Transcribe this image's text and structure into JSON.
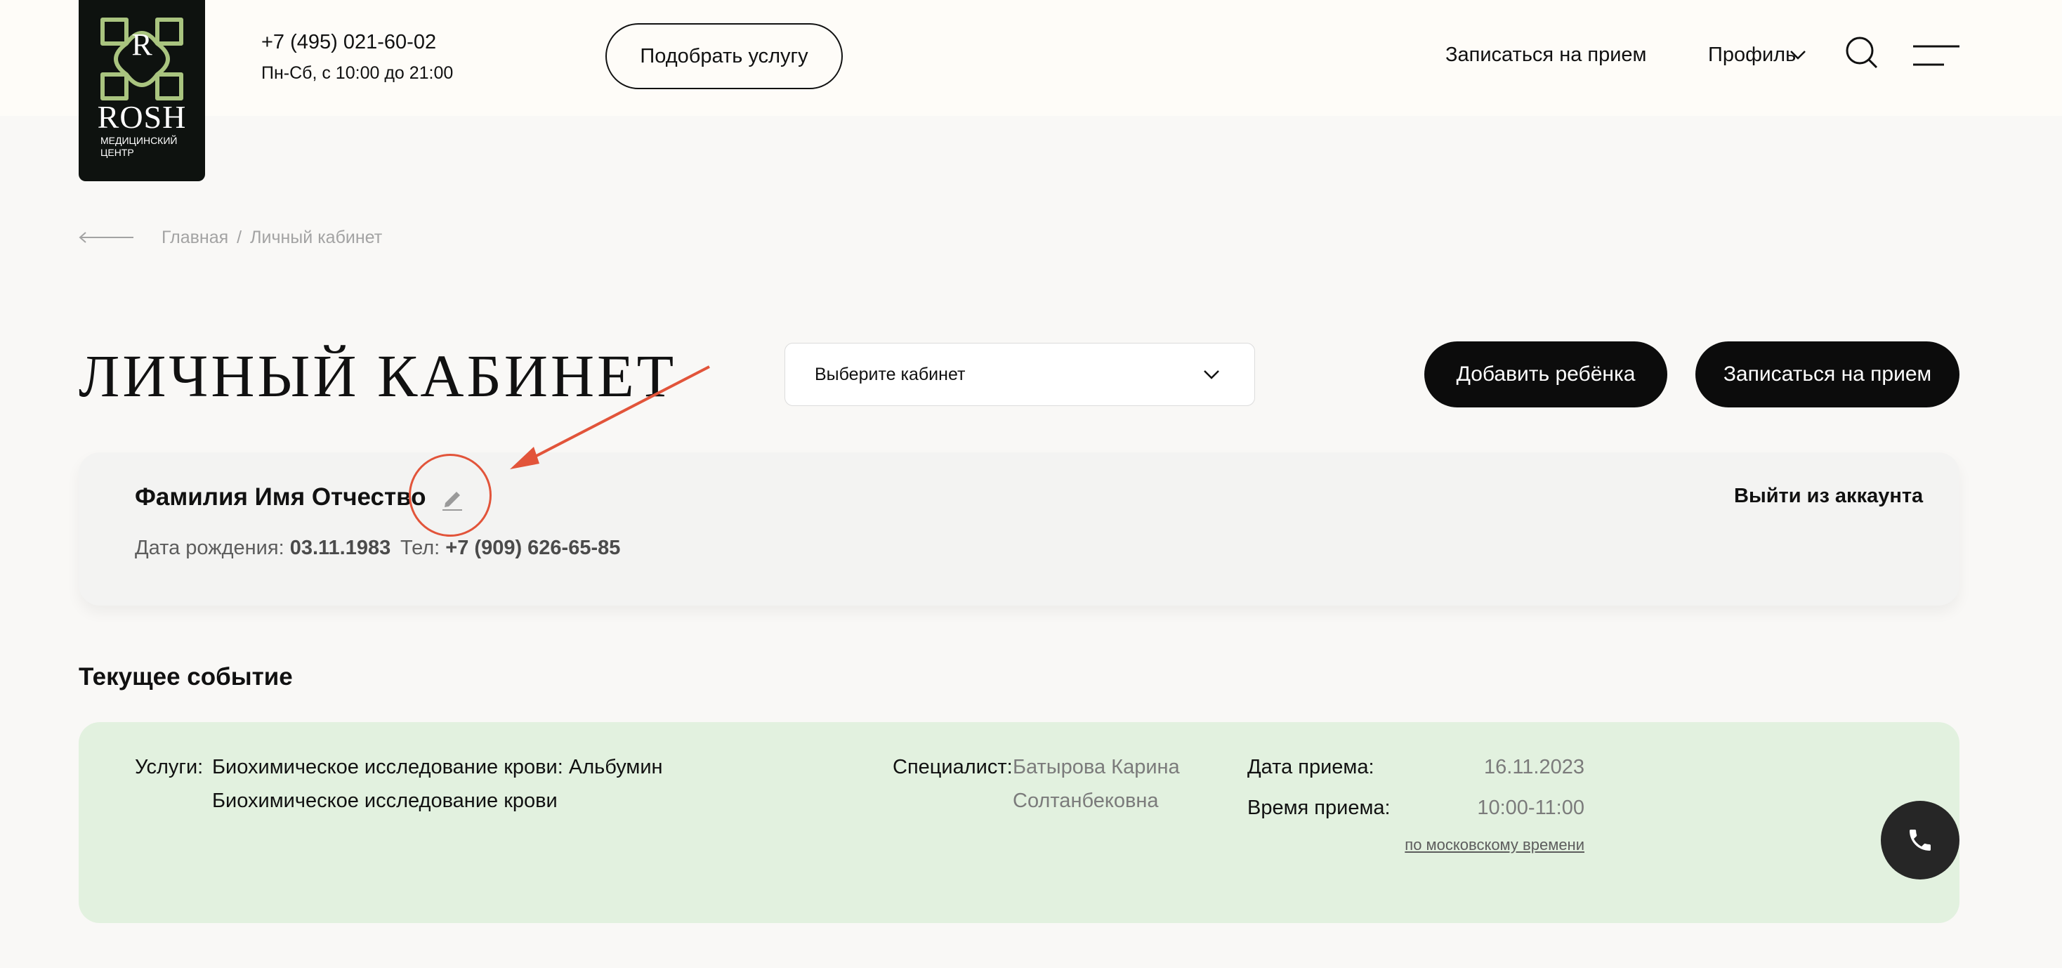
{
  "header": {
    "logo_letter": "R",
    "logo_name": "ROSH",
    "logo_sub": "Медицинский центр",
    "phone": "+7 (495) 021-60-02",
    "hours": "Пн-Сб, с 10:00 до 21:00",
    "pick_service": "Подобрать услугу",
    "book_link": "Записаться на прием",
    "profile": "Профиль"
  },
  "breadcrumb": {
    "home": "Главная",
    "separator": "/",
    "current": "Личный кабинет"
  },
  "page": {
    "title": "ЛИЧНЫЙ КАБИНЕТ",
    "select_placeholder": "Выберите кабинет",
    "add_child": "Добавить ребёнка",
    "book": "Записаться на прием"
  },
  "profile_card": {
    "name": "Фамилия Имя Отчество",
    "logout": "Выйти из аккаунта",
    "birth_label": "Дата рождения:",
    "birth_value": "03.11.1983",
    "tel_label": "Тел:",
    "tel_value": "+7 (909) 626-65-85"
  },
  "current_event": {
    "section_title": "Текущее событие",
    "services_label": "Услуги:",
    "services": [
      "Биохимическое исследование крови: Альбумин",
      "Биохимическое исследование крови"
    ],
    "specialist_label": "Специалист:",
    "specialist_lines": [
      "Батырова Карина",
      "Солтанбековна"
    ],
    "date_label": "Дата приема:",
    "date_value": "16.11.2023",
    "time_label": "Время приема:",
    "time_value": "10:00-11:00",
    "timezone_note": "по московскому времени"
  },
  "colors": {
    "background": "#f9f8f6",
    "dark": "#0c0c0c",
    "event_card": "#e2f1df",
    "annotation": "#e2543a",
    "logo_green": "#a9c47f"
  }
}
